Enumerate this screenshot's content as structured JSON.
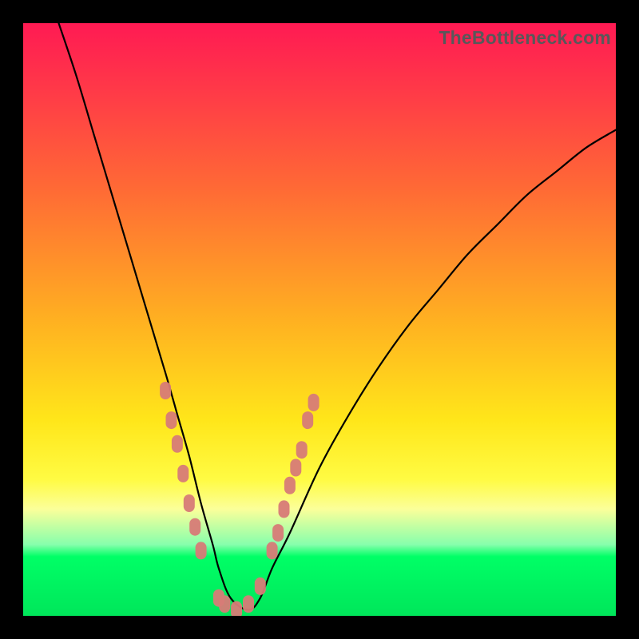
{
  "watermark": "TheBottleneck.com",
  "chart_data": {
    "type": "line",
    "title": "",
    "xlabel": "",
    "ylabel": "",
    "xlim": [
      0,
      100
    ],
    "ylim": [
      0,
      100
    ],
    "grid": false,
    "series": [
      {
        "name": "bottleneck-curve",
        "x": [
          6,
          9,
          12,
          15,
          18,
          21,
          24,
          26,
          28,
          30,
          32,
          33,
          35,
          38,
          40,
          42,
          45,
          50,
          55,
          60,
          65,
          70,
          75,
          80,
          85,
          90,
          95,
          100
        ],
        "y": [
          100,
          91,
          81,
          71,
          61,
          51,
          41,
          34,
          27,
          19,
          12,
          8,
          3,
          1,
          3,
          8,
          14,
          25,
          34,
          42,
          49,
          55,
          61,
          66,
          71,
          75,
          79,
          82
        ]
      }
    ],
    "markers": {
      "name": "marker-cluster",
      "points": [
        {
          "x": 24,
          "y": 38
        },
        {
          "x": 25,
          "y": 33
        },
        {
          "x": 26,
          "y": 29
        },
        {
          "x": 27,
          "y": 24
        },
        {
          "x": 28,
          "y": 19
        },
        {
          "x": 29,
          "y": 15
        },
        {
          "x": 30,
          "y": 11
        },
        {
          "x": 33,
          "y": 3
        },
        {
          "x": 34,
          "y": 2
        },
        {
          "x": 36,
          "y": 1
        },
        {
          "x": 38,
          "y": 2
        },
        {
          "x": 40,
          "y": 5
        },
        {
          "x": 42,
          "y": 11
        },
        {
          "x": 43,
          "y": 14
        },
        {
          "x": 44,
          "y": 18
        },
        {
          "x": 45,
          "y": 22
        },
        {
          "x": 46,
          "y": 25
        },
        {
          "x": 47,
          "y": 28
        },
        {
          "x": 48,
          "y": 33
        },
        {
          "x": 49,
          "y": 36
        }
      ]
    },
    "gradient_stops": [
      {
        "pos": 0,
        "color": "#ff1a53"
      },
      {
        "pos": 50,
        "color": "#ffb021"
      },
      {
        "pos": 77,
        "color": "#fffb43"
      },
      {
        "pos": 90,
        "color": "#00ff66"
      },
      {
        "pos": 100,
        "color": "#00e65a"
      }
    ]
  }
}
